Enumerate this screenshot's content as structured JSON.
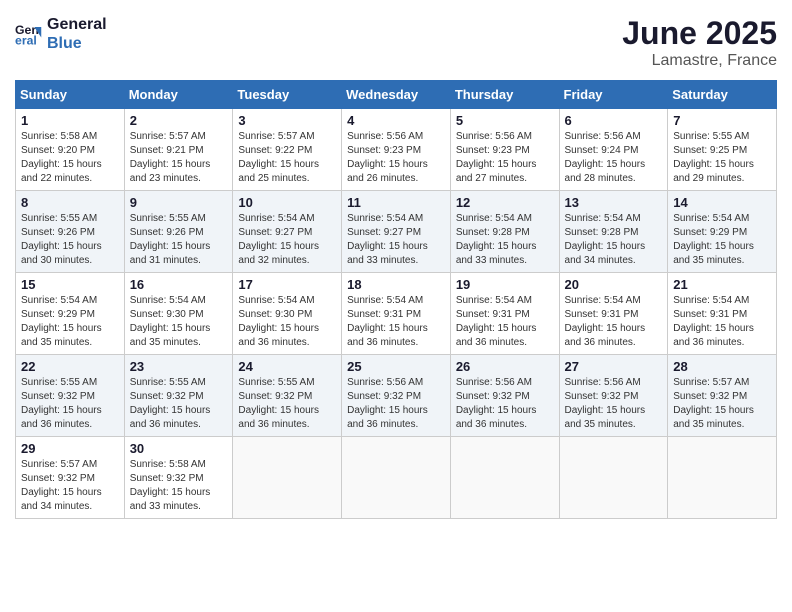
{
  "header": {
    "logo_line1": "General",
    "logo_line2": "Blue",
    "month": "June 2025",
    "location": "Lamastre, France"
  },
  "weekdays": [
    "Sunday",
    "Monday",
    "Tuesday",
    "Wednesday",
    "Thursday",
    "Friday",
    "Saturday"
  ],
  "weeks": [
    [
      {
        "day": "1",
        "sunrise": "5:58 AM",
        "sunset": "9:20 PM",
        "daylight": "15 hours and 22 minutes."
      },
      {
        "day": "2",
        "sunrise": "5:57 AM",
        "sunset": "9:21 PM",
        "daylight": "15 hours and 23 minutes."
      },
      {
        "day": "3",
        "sunrise": "5:57 AM",
        "sunset": "9:22 PM",
        "daylight": "15 hours and 25 minutes."
      },
      {
        "day": "4",
        "sunrise": "5:56 AM",
        "sunset": "9:23 PM",
        "daylight": "15 hours and 26 minutes."
      },
      {
        "day": "5",
        "sunrise": "5:56 AM",
        "sunset": "9:23 PM",
        "daylight": "15 hours and 27 minutes."
      },
      {
        "day": "6",
        "sunrise": "5:56 AM",
        "sunset": "9:24 PM",
        "daylight": "15 hours and 28 minutes."
      },
      {
        "day": "7",
        "sunrise": "5:55 AM",
        "sunset": "9:25 PM",
        "daylight": "15 hours and 29 minutes."
      }
    ],
    [
      {
        "day": "8",
        "sunrise": "5:55 AM",
        "sunset": "9:26 PM",
        "daylight": "15 hours and 30 minutes."
      },
      {
        "day": "9",
        "sunrise": "5:55 AM",
        "sunset": "9:26 PM",
        "daylight": "15 hours and 31 minutes."
      },
      {
        "day": "10",
        "sunrise": "5:54 AM",
        "sunset": "9:27 PM",
        "daylight": "15 hours and 32 minutes."
      },
      {
        "day": "11",
        "sunrise": "5:54 AM",
        "sunset": "9:27 PM",
        "daylight": "15 hours and 33 minutes."
      },
      {
        "day": "12",
        "sunrise": "5:54 AM",
        "sunset": "9:28 PM",
        "daylight": "15 hours and 33 minutes."
      },
      {
        "day": "13",
        "sunrise": "5:54 AM",
        "sunset": "9:28 PM",
        "daylight": "15 hours and 34 minutes."
      },
      {
        "day": "14",
        "sunrise": "5:54 AM",
        "sunset": "9:29 PM",
        "daylight": "15 hours and 35 minutes."
      }
    ],
    [
      {
        "day": "15",
        "sunrise": "5:54 AM",
        "sunset": "9:29 PM",
        "daylight": "15 hours and 35 minutes."
      },
      {
        "day": "16",
        "sunrise": "5:54 AM",
        "sunset": "9:30 PM",
        "daylight": "15 hours and 35 minutes."
      },
      {
        "day": "17",
        "sunrise": "5:54 AM",
        "sunset": "9:30 PM",
        "daylight": "15 hours and 36 minutes."
      },
      {
        "day": "18",
        "sunrise": "5:54 AM",
        "sunset": "9:31 PM",
        "daylight": "15 hours and 36 minutes."
      },
      {
        "day": "19",
        "sunrise": "5:54 AM",
        "sunset": "9:31 PM",
        "daylight": "15 hours and 36 minutes."
      },
      {
        "day": "20",
        "sunrise": "5:54 AM",
        "sunset": "9:31 PM",
        "daylight": "15 hours and 36 minutes."
      },
      {
        "day": "21",
        "sunrise": "5:54 AM",
        "sunset": "9:31 PM",
        "daylight": "15 hours and 36 minutes."
      }
    ],
    [
      {
        "day": "22",
        "sunrise": "5:55 AM",
        "sunset": "9:32 PM",
        "daylight": "15 hours and 36 minutes."
      },
      {
        "day": "23",
        "sunrise": "5:55 AM",
        "sunset": "9:32 PM",
        "daylight": "15 hours and 36 minutes."
      },
      {
        "day": "24",
        "sunrise": "5:55 AM",
        "sunset": "9:32 PM",
        "daylight": "15 hours and 36 minutes."
      },
      {
        "day": "25",
        "sunrise": "5:56 AM",
        "sunset": "9:32 PM",
        "daylight": "15 hours and 36 minutes."
      },
      {
        "day": "26",
        "sunrise": "5:56 AM",
        "sunset": "9:32 PM",
        "daylight": "15 hours and 36 minutes."
      },
      {
        "day": "27",
        "sunrise": "5:56 AM",
        "sunset": "9:32 PM",
        "daylight": "15 hours and 35 minutes."
      },
      {
        "day": "28",
        "sunrise": "5:57 AM",
        "sunset": "9:32 PM",
        "daylight": "15 hours and 35 minutes."
      }
    ],
    [
      {
        "day": "29",
        "sunrise": "5:57 AM",
        "sunset": "9:32 PM",
        "daylight": "15 hours and 34 minutes."
      },
      {
        "day": "30",
        "sunrise": "5:58 AM",
        "sunset": "9:32 PM",
        "daylight": "15 hours and 33 minutes."
      },
      {
        "day": "",
        "sunrise": "",
        "sunset": "",
        "daylight": ""
      },
      {
        "day": "",
        "sunrise": "",
        "sunset": "",
        "daylight": ""
      },
      {
        "day": "",
        "sunrise": "",
        "sunset": "",
        "daylight": ""
      },
      {
        "day": "",
        "sunrise": "",
        "sunset": "",
        "daylight": ""
      },
      {
        "day": "",
        "sunrise": "",
        "sunset": "",
        "daylight": ""
      }
    ]
  ]
}
